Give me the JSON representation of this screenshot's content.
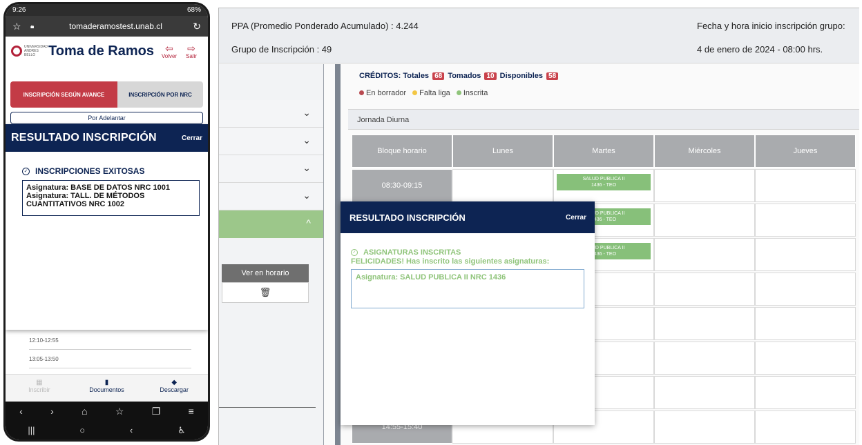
{
  "phone": {
    "status_time": "9:26",
    "status_battery": "68%",
    "browser": {
      "url": "tomaderamostest.unab.cl"
    },
    "header": {
      "logo_text": "UNIVERSIDAD ANDRES BELLO",
      "title": "Toma de Ramos",
      "volver_label": "Volver",
      "salir_label": "Salir"
    },
    "tabs": [
      {
        "label": "INSCRIPCIÓN SEGÚN AVANCE",
        "active": true
      },
      {
        "label": "INSCRIPCIÓN POR NRC",
        "active": false
      }
    ],
    "nav_label": "Por Adelantar",
    "modal": {
      "title": "RESULTADO INSCRIPCIÓN",
      "close_label": "Cerrar",
      "heading": "INSCRIPCIONES EXITOSAS",
      "items": [
        "Asignatura: BASE DE DATOS NRC 1001",
        "Asignatura: TALL. DE MÉTODOS CUANTITATIVOS NRC 1002"
      ]
    },
    "times": [
      "12:10-12:55",
      "13:05-13:50"
    ],
    "bottom_nav": [
      {
        "label": "Inscribir",
        "icon": "grid-icon",
        "enabled": false
      },
      {
        "label": "Documentos",
        "icon": "document-icon",
        "enabled": true
      },
      {
        "label": "Descargar",
        "icon": "download-icon",
        "enabled": true
      }
    ]
  },
  "desktop": {
    "ppa_label": "PPA (Promedio Ponderado Acumulado) : 4.244",
    "grupo_label": "Grupo de Inscripción : 49",
    "fecha_label": "Fecha y hora inicio inscripción grupo:",
    "fecha_value": "4 de enero de 2024 - 08:00 hrs.",
    "left_panel": {
      "ver_en_horario": "Ver en horario"
    },
    "credits": {
      "label": "CRÉDITOS: Totales",
      "totales": "68",
      "tomados_label": "Tomados",
      "tomados": "10",
      "disponibles_label": "Disponibles",
      "disponibles": "58"
    },
    "legend": {
      "borrador": "En borrador",
      "falta_liga": "Falta liga",
      "inscrita": "Inscrita",
      "colors": {
        "borrador": "#b84a50",
        "falta_liga": "#f3c744",
        "inscrita": "#8fc47a"
      }
    },
    "jornada": "Jornada Diurna",
    "schedule_headers": [
      "Bloque horario",
      "Lunes",
      "Martes",
      "Miércoles",
      "Jueves"
    ],
    "schedule_times": [
      "08:30-09:15",
      "",
      "",
      "",
      "",
      "",
      "",
      "14:55-15:40"
    ],
    "courses": [
      {
        "name": "SALUD PUBLICA II",
        "code": "1436 - TEO",
        "partial_name": "PUBLICA II",
        "partial_code": "36 - TEO"
      }
    ],
    "modal": {
      "title": "RESULTADO INSCRIPCIÓN",
      "close_label": "Cerrar",
      "heading": "ASIGNATURAS INSCRITAS",
      "subheading": "FELICIDADES! Has inscrito las siguientes asignaturas:",
      "items": [
        "Asignatura: SALUD PUBLICA II NRC 1436"
      ]
    }
  },
  "colors": {
    "navy": "#0d2453",
    "accent_red": "#c33b46",
    "green": "#8fc47a"
  }
}
